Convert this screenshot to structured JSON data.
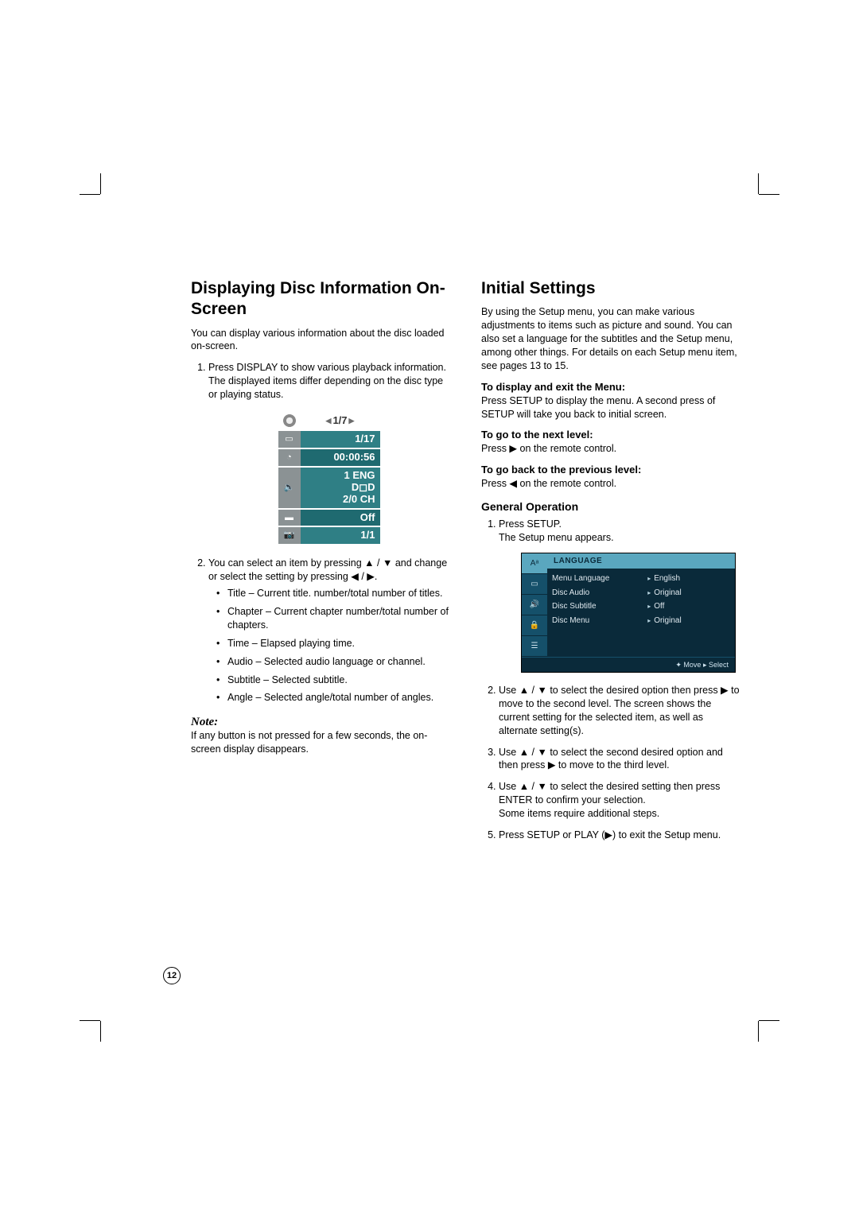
{
  "page_number": "12",
  "left": {
    "heading": "Displaying Disc Information On-Screen",
    "intro": "You can display various information about the disc loaded on-screen.",
    "step1a": "Press DISPLAY to show various playback information.",
    "step1b": "The displayed items differ depending on the disc type or playing status.",
    "osd": {
      "title": "1/7",
      "chapter": "1/17",
      "time": "00:00:56",
      "audio_line1": "1 ENG",
      "audio_line2": "D◻D",
      "audio_line3": "2/0  CH",
      "subtitle": "Off",
      "angle": "1/1"
    },
    "step2_lead": "You can select an item by pressing ▲ / ▼ and change or select the setting by pressing ◀ / ▶.",
    "bullets": [
      "Title – Current title. number/total number of titles.",
      "Chapter – Current chapter number/total number of chapters.",
      "Time – Elapsed playing time.",
      "Audio – Selected audio language or channel.",
      "Subtitle – Selected subtitle.",
      "Angle – Selected angle/total number of angles."
    ],
    "note_label": "Note:",
    "note_body": "If any button is not pressed for a few seconds, the on-screen display disappears."
  },
  "right": {
    "heading": "Initial Settings",
    "intro": "By using the Setup menu, you can make various adjustments to items such as picture and sound. You can also set a language for the subtitles and the Setup menu, among other things. For details on each Setup menu item, see pages 13 to 15.",
    "h_display_exit": "To display and exit the Menu:",
    "p_display_exit": "Press SETUP to display the menu. A second press of SETUP will take you back to initial screen.",
    "h_next": "To go to the next level:",
    "p_next": "Press ▶ on the remote control.",
    "h_prev": "To go back to the previous level:",
    "p_prev": "Press ◀ on the remote control.",
    "h_general": "General Operation",
    "go_step1a": "Press SETUP.",
    "go_step1b": "The Setup menu appears.",
    "setup_menu": {
      "title": "LANGUAGE",
      "left_items": [
        "Menu Language",
        "Disc Audio",
        "Disc Subtitle",
        "Disc Menu"
      ],
      "right_items": [
        "English",
        "Original",
        "Off",
        "Original"
      ],
      "footer_move": "Move",
      "footer_select": "Select"
    },
    "go_step2": "Use ▲ / ▼ to select the desired option then press ▶ to move to the second level. The screen shows the current setting for the selected item, as well as alternate setting(s).",
    "go_step3": "Use ▲ / ▼ to select the second desired option and then press ▶ to move to the third level.",
    "go_step4a": "Use ▲ / ▼ to select the desired setting then press ENTER to confirm your selection.",
    "go_step4b": "Some items require additional steps.",
    "go_step5": "Press SETUP or PLAY (▶) to exit the Setup menu."
  }
}
